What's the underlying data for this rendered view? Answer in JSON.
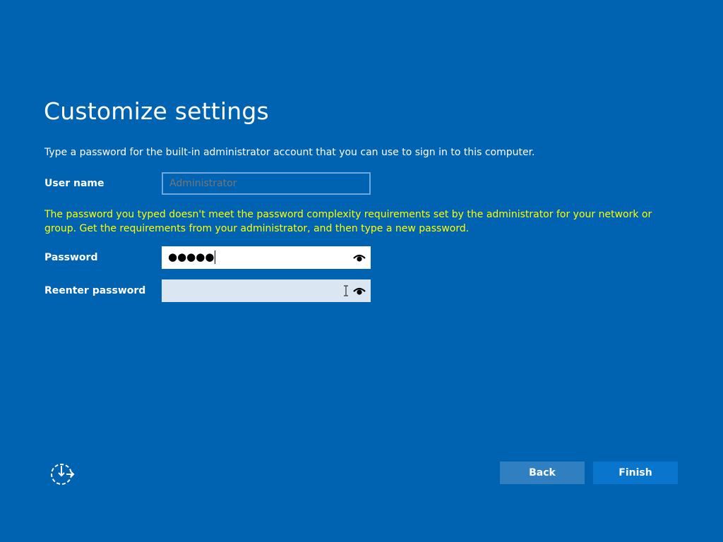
{
  "page": {
    "title": "Customize settings",
    "description": "Type a password for the built-in administrator account that you can use to sign in to this computer."
  },
  "form": {
    "username": {
      "label": "User name",
      "placeholder": "Administrator",
      "value": ""
    },
    "warning": "The password you typed doesn't meet the password complexity requirements set by the administrator for your network or group. Get the requirements from your administrator, and then type a new password.",
    "password": {
      "label": "Password",
      "value_masked": "●●●●●"
    },
    "reenter_password": {
      "label": "Reenter password",
      "value_masked": ""
    }
  },
  "footer": {
    "back_label": "Back",
    "finish_label": "Finish",
    "accessibility_icon": "ease-of-access-icon"
  },
  "colors": {
    "background": "#0063b1",
    "warning_text": "#ffff00",
    "back_button": "#2f7fc1",
    "finish_button": "#0a75cc"
  }
}
